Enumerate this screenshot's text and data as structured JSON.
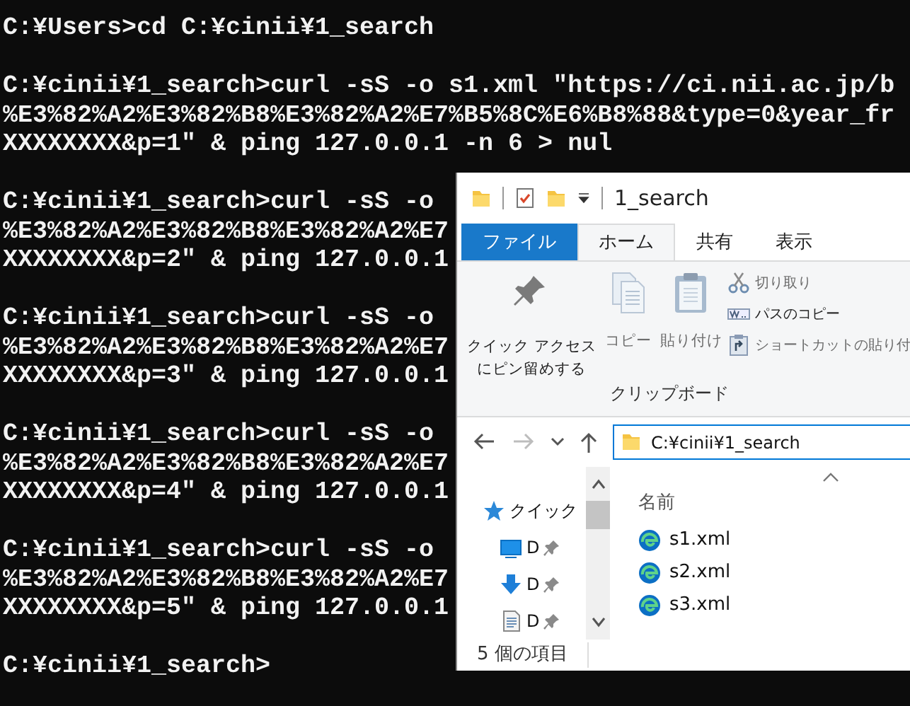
{
  "console": {
    "blocks": [
      {
        "lines": [
          "C:¥Users>cd C:¥cinii¥1_search"
        ]
      },
      {
        "lines": [
          "C:¥cinii¥1_search>curl -sS -o s1.xml \"https://ci.nii.ac.jp/b",
          "%E3%82%A2%E3%82%B8%E3%82%A2%E7%B5%8C%E6%B8%88&type=0&year_fr",
          "XXXXXXXX&p=1\" & ping 127.0.0.1 -n 6 > nul"
        ]
      },
      {
        "lines": [
          "C:¥cinii¥1_search>curl -sS -o",
          "%E3%82%A2%E3%82%B8%E3%82%A2%E7",
          "XXXXXXXX&p=2\" & ping 127.0.0.1"
        ]
      },
      {
        "lines": [
          "C:¥cinii¥1_search>curl -sS -o",
          "%E3%82%A2%E3%82%B8%E3%82%A2%E7",
          "XXXXXXXX&p=3\" & ping 127.0.0.1"
        ]
      },
      {
        "lines": [
          "C:¥cinii¥1_search>curl -sS -o",
          "%E3%82%A2%E3%82%B8%E3%82%A2%E7",
          "XXXXXXXX&p=4\" & ping 127.0.0.1"
        ]
      },
      {
        "lines": [
          "C:¥cinii¥1_search>curl -sS -o",
          "%E3%82%A2%E3%82%B8%E3%82%A2%E7",
          "XXXXXXXX&p=5\" & ping 127.0.0.1"
        ]
      },
      {
        "lines": [
          "C:¥cinii¥1_search>"
        ]
      }
    ]
  },
  "explorer": {
    "title": "1_search",
    "tabs": [
      {
        "label": "ファイル",
        "kind": "file",
        "selected": false
      },
      {
        "label": "ホーム",
        "kind": "tab",
        "selected": true
      },
      {
        "label": "共有",
        "kind": "tab",
        "selected": false
      },
      {
        "label": "表示",
        "kind": "tab",
        "selected": false
      }
    ],
    "ribbon": {
      "group": "クリップボード",
      "large_commands": [
        {
          "label_lines": [
            "クイック アクセス",
            "にピン留めする"
          ],
          "kind": "pin",
          "disabled": false
        },
        {
          "label_lines": [
            "コピー"
          ],
          "kind": "copy",
          "disabled": true
        },
        {
          "label_lines": [
            "貼り付け"
          ],
          "kind": "paste",
          "disabled": true
        }
      ],
      "small_commands": [
        {
          "label": "切り取り",
          "kind": "cut",
          "disabled": true
        },
        {
          "label": "パスのコピー",
          "kind": "copy-path",
          "disabled": false
        },
        {
          "label": "ショートカットの貼り付",
          "kind": "paste-shortcut",
          "disabled": true
        }
      ]
    },
    "nav_buttons": [
      {
        "kind": "back",
        "disabled": false
      },
      {
        "kind": "forward",
        "disabled": true
      },
      {
        "kind": "recent",
        "disabled": false
      },
      {
        "kind": "up",
        "disabled": false
      }
    ],
    "address": {
      "value": "C:¥cinii¥1_search"
    },
    "sidebar": {
      "items": [
        {
          "label": "クイック",
          "kind": "star",
          "pinned": false
        },
        {
          "label": "D",
          "kind": "desktop",
          "pinned": true
        },
        {
          "label": "D",
          "kind": "downloads",
          "pinned": true
        },
        {
          "label": "D",
          "kind": "documents",
          "pinned": true
        }
      ]
    },
    "file_list": {
      "column": "名前",
      "files": [
        {
          "name": "s1.xml"
        },
        {
          "name": "s2.xml"
        },
        {
          "name": "s3.xml"
        }
      ]
    },
    "status_bar": "5 個の項目"
  }
}
